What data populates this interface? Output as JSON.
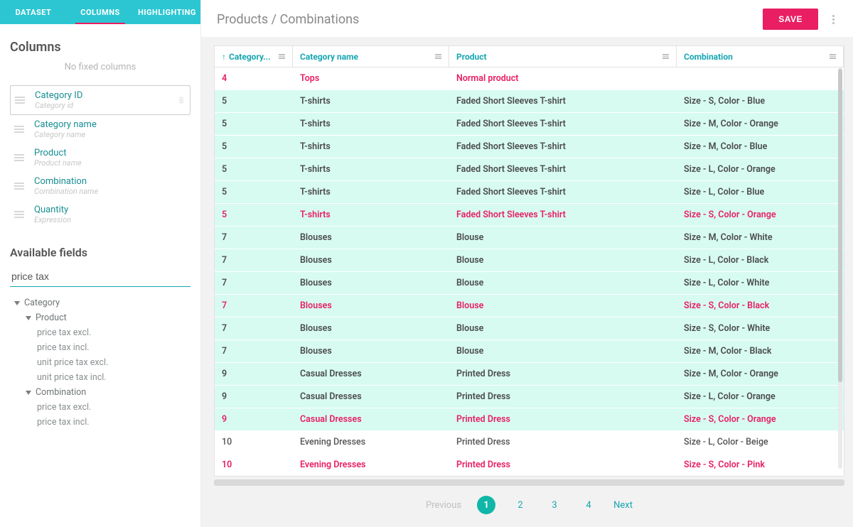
{
  "tabs": {
    "dataset": "DATASET",
    "columns": "COLUMNS",
    "highlighting": "HIGHLIGHTING",
    "active": "columns"
  },
  "panel": {
    "title": "Columns",
    "hint": "No fixed columns",
    "items": [
      {
        "name": "Category ID",
        "sub": "Category id",
        "selected": true
      },
      {
        "name": "Category name",
        "sub": "Category name",
        "selected": false
      },
      {
        "name": "Product",
        "sub": "Product name",
        "selected": false
      },
      {
        "name": "Combination",
        "sub": "Combination name",
        "selected": false
      },
      {
        "name": "Quantity",
        "sub": "Expression",
        "selected": false
      }
    ],
    "available_title": "Available fields",
    "search_value": "price tax",
    "tree": {
      "category": "Category",
      "product": "Product",
      "product_fields": [
        "price tax excl.",
        "price tax incl.",
        "unit price tax excl.",
        "unit price tax incl."
      ],
      "combination": "Combination",
      "combination_fields": [
        "price tax excl.",
        "price tax incl."
      ]
    }
  },
  "header": {
    "title": "Products / Combinations",
    "save": "SAVE"
  },
  "grid": {
    "columns": [
      {
        "label": "Category...",
        "sort": true
      },
      {
        "label": "Category name"
      },
      {
        "label": "Product"
      },
      {
        "label": "Combination"
      }
    ],
    "rows": [
      {
        "c": [
          "4",
          "Tops",
          "Normal product",
          ""
        ],
        "hl": false,
        "pink": true
      },
      {
        "c": [
          "5",
          "T-shirts",
          "Faded Short Sleeves T-shirt",
          "Size - S, Color - Blue"
        ],
        "hl": true
      },
      {
        "c": [
          "5",
          "T-shirts",
          "Faded Short Sleeves T-shirt",
          "Size - M, Color - Orange"
        ],
        "hl": true
      },
      {
        "c": [
          "5",
          "T-shirts",
          "Faded Short Sleeves T-shirt",
          "Size - M, Color - Blue"
        ],
        "hl": true
      },
      {
        "c": [
          "5",
          "T-shirts",
          "Faded Short Sleeves T-shirt",
          "Size - L, Color - Orange"
        ],
        "hl": true
      },
      {
        "c": [
          "5",
          "T-shirts",
          "Faded Short Sleeves T-shirt",
          "Size - L, Color - Blue"
        ],
        "hl": true
      },
      {
        "c": [
          "5",
          "T-shirts",
          "Faded Short Sleeves T-shirt",
          "Size - S, Color - Orange"
        ],
        "hl": true,
        "pink": true
      },
      {
        "c": [
          "7",
          "Blouses",
          "Blouse",
          "Size - M, Color - White"
        ],
        "hl": true
      },
      {
        "c": [
          "7",
          "Blouses",
          "Blouse",
          "Size - L, Color - Black"
        ],
        "hl": true
      },
      {
        "c": [
          "7",
          "Blouses",
          "Blouse",
          "Size - L, Color - White"
        ],
        "hl": true
      },
      {
        "c": [
          "7",
          "Blouses",
          "Blouse",
          "Size - S, Color - Black"
        ],
        "hl": true,
        "pink": true
      },
      {
        "c": [
          "7",
          "Blouses",
          "Blouse",
          "Size - S, Color - White"
        ],
        "hl": true
      },
      {
        "c": [
          "7",
          "Blouses",
          "Blouse",
          "Size - M, Color - Black"
        ],
        "hl": true
      },
      {
        "c": [
          "9",
          "Casual Dresses",
          "Printed Dress",
          "Size - M, Color - Orange"
        ],
        "hl": true
      },
      {
        "c": [
          "9",
          "Casual Dresses",
          "Printed Dress",
          "Size - L, Color - Orange"
        ],
        "hl": true
      },
      {
        "c": [
          "9",
          "Casual Dresses",
          "Printed Dress",
          "Size - S, Color - Orange"
        ],
        "hl": true,
        "pink": true
      },
      {
        "c": [
          "10",
          "Evening Dresses",
          "Printed Dress",
          "Size - L, Color - Beige"
        ],
        "hl": false,
        "normal": true
      },
      {
        "c": [
          "10",
          "Evening Dresses",
          "Printed Dress",
          "Size - S, Color - Pink"
        ],
        "hl": false,
        "pink": true
      }
    ]
  },
  "pager": {
    "prev": "Previous",
    "next": "Next",
    "pages": [
      "1",
      "2",
      "3",
      "4"
    ],
    "active": 0
  }
}
